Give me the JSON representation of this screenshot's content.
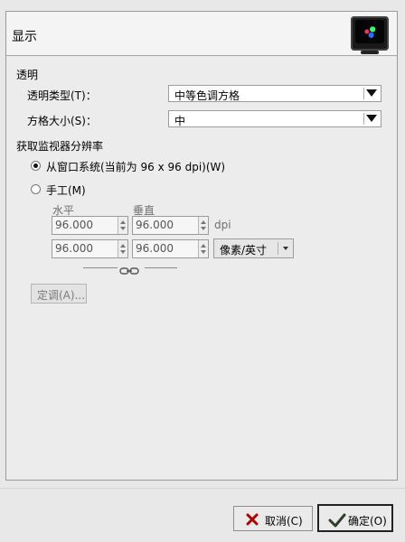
{
  "dialog": {
    "title": "显示",
    "icon": "monitor-color-icon"
  },
  "transparency": {
    "section_title": "透明",
    "type_label": "透明类型(T)：",
    "type_value": "中等色调方格",
    "size_label": "方格大小(S)：",
    "size_value": "中"
  },
  "monitor_resolution": {
    "section_title": "获取监视器分辨率",
    "option_system": "从窗口系统(当前为 96 x 96 dpi)(W)",
    "option_manual": "手工(M)",
    "selected": "system",
    "horizontal_label": "水平",
    "vertical_label": "垂直",
    "row1": {
      "h": "96.000",
      "v": "96.000",
      "unit_text": "dpi"
    },
    "row2": {
      "h": "96.000",
      "v": "96.000"
    },
    "unit_select": "像素/英寸",
    "calibrate_button": "定调(A)..."
  },
  "footer": {
    "cancel": "取消(C)",
    "ok": "确定(O)"
  }
}
